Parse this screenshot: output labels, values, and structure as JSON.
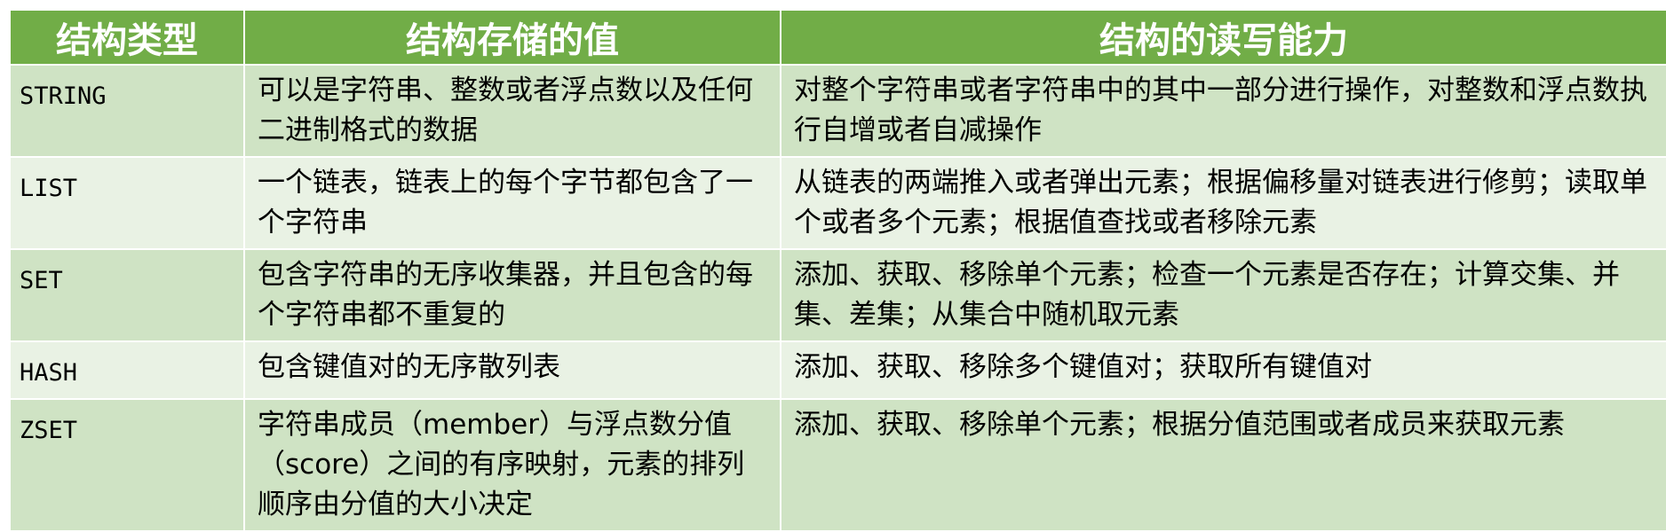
{
  "table": {
    "headers": [
      "结构类型",
      "结构存储的值",
      "结构的读写能力"
    ],
    "rows": [
      {
        "type": "STRING",
        "value": "可以是字符串、整数或者浮点数以及任何二进制格式的数据",
        "ops": "对整个字符串或者字符串中的其中一部分进行操作，对整数和浮点数执行自增或者自减操作"
      },
      {
        "type": "LIST",
        "value": "一个链表，链表上的每个字节都包含了一个字符串",
        "ops": "从链表的两端推入或者弹出元素；根据偏移量对链表进行修剪；读取单个或者多个元素；根据值查找或者移除元素"
      },
      {
        "type": "SET",
        "value": "包含字符串的无序收集器，并且包含的每个字符串都不重复的",
        "ops": "添加、获取、移除单个元素；检查一个元素是否存在；计算交集、并集、差集；从集合中随机取元素"
      },
      {
        "type": "HASH",
        "value": "包含键值对的无序散列表",
        "ops": "添加、获取、移除多个键值对；获取所有键值对"
      },
      {
        "type": "ZSET",
        "value": "字符串成员（member）与浮点数分值（score）之间的有序映射，元素的排列顺序由分值的大小决定",
        "ops": "添加、获取、移除单个元素；根据分值范围或者成员来获取元素"
      }
    ]
  },
  "colors": {
    "header_bg": "#71ad47",
    "row_dark": "#cfe3c4",
    "row_light": "#e9f2e4"
  }
}
